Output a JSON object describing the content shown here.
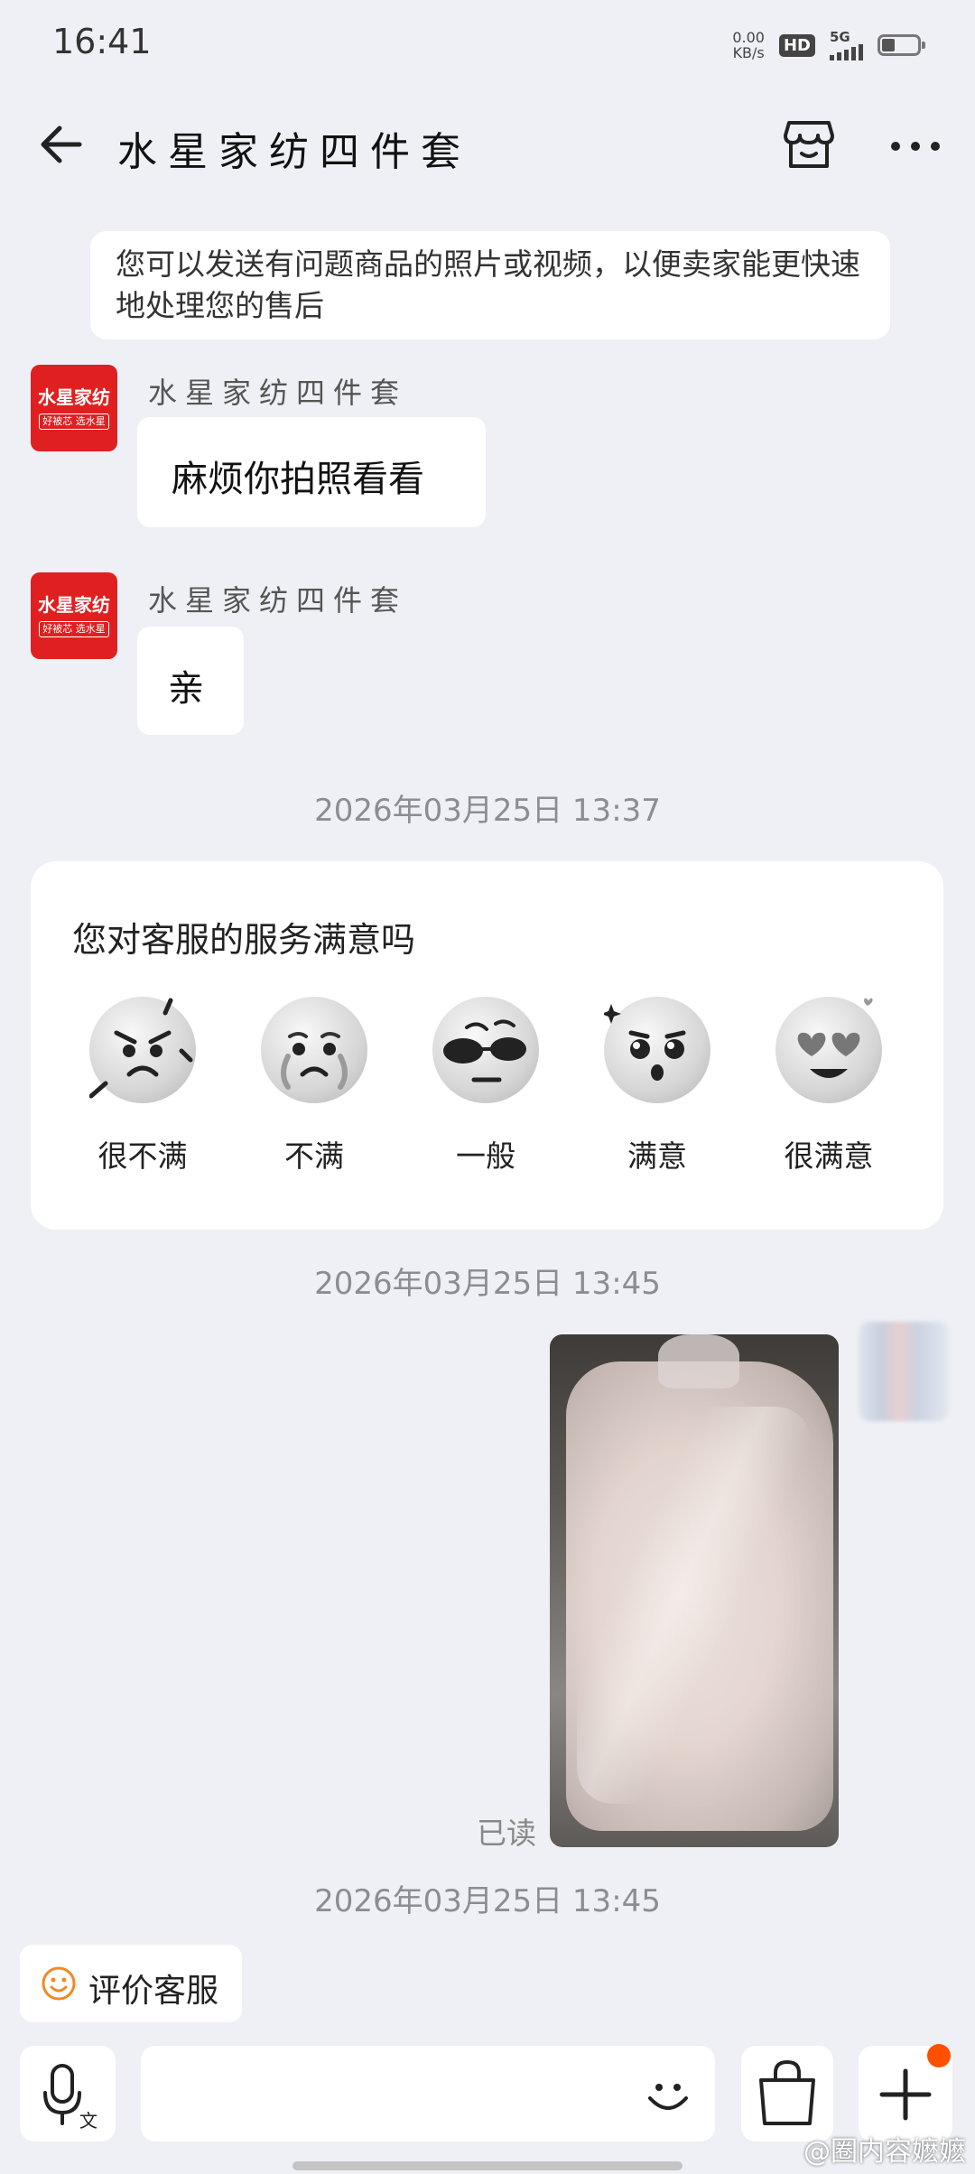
{
  "status_bar": {
    "time": "16:41",
    "net_speed_value": "0.00",
    "net_speed_unit": "KB/s",
    "hd_badge": "HD",
    "network": "5G"
  },
  "header": {
    "title": "水星家纺四件套",
    "back_icon": "arrow-left-icon",
    "shop_icon": "storefront-icon",
    "more_icon": "more-dots-icon"
  },
  "notice": {
    "text": "您可以发送有问题商品的照片或视频，以便卖家能更快速地处理您的售后"
  },
  "merchant": {
    "avatar_line1": "水星家纺",
    "avatar_line2": "好被芯 选水星",
    "avatar_color": "#e02020"
  },
  "messages": [
    {
      "sender": "水星家纺四件套",
      "text": "麻烦你拍照看看"
    },
    {
      "sender": "水星家纺四件套",
      "text": "亲"
    }
  ],
  "timestamps": [
    "2026年03月25日 13:37",
    "2026年03月25日 13:45",
    "2026年03月25日 13:45"
  ],
  "survey": {
    "question": "您对客服的服务满意吗",
    "options": [
      {
        "label": "很不满",
        "icon": "angry-face-icon"
      },
      {
        "label": "不满",
        "icon": "crying-face-icon"
      },
      {
        "label": "一般",
        "icon": "sunglasses-face-icon"
      },
      {
        "label": "满意",
        "icon": "starry-eyes-face-icon"
      },
      {
        "label": "很满意",
        "icon": "heart-eyes-face-icon"
      }
    ]
  },
  "my_message": {
    "read_status": "已读",
    "image_icon": "photo-comforter-in-plastic-bag"
  },
  "rate_service": {
    "label": "评价客服",
    "icon": "smiley-icon"
  },
  "input_bar": {
    "voice_icon": "microphone-icon",
    "emoji_icon": "smiley-icon",
    "order_icon": "shopping-bag-icon",
    "more_icon": "plus-icon",
    "badge_color": "#ff5000"
  },
  "watermark": "@圈内容嬷嬷"
}
